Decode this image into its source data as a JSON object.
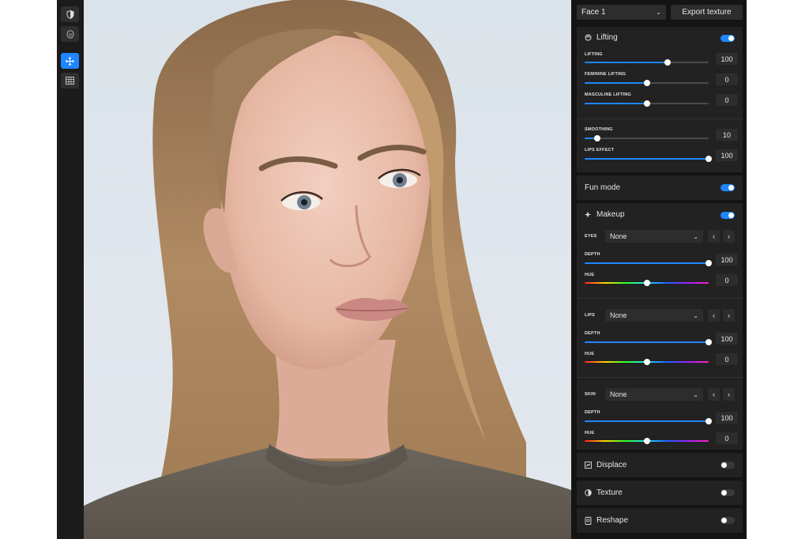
{
  "toolbar": {
    "tools": [
      {
        "name": "shield-icon",
        "active": false
      },
      {
        "name": "face-mask-icon",
        "active": false
      },
      {
        "name": "move-icon",
        "active": true
      },
      {
        "name": "grid-icon",
        "active": false
      }
    ]
  },
  "panel": {
    "face_select": "Face 1",
    "export_label": "Export texture",
    "lifting": {
      "title": "Lifting",
      "enabled": true,
      "sliders": [
        {
          "label": "LIFTING",
          "value": "100",
          "fraction": 0.67
        },
        {
          "label": "FEMININE LIFTING",
          "value": "0",
          "fraction": 0.5
        },
        {
          "label": "MASCULINE LIFTING",
          "value": "0",
          "fraction": 0.5
        }
      ],
      "extra_sliders": [
        {
          "label": "SMOOTHING",
          "value": "10",
          "fraction": 0.1
        },
        {
          "label": "LIPS EFFECT",
          "value": "100",
          "fraction": 1.0
        }
      ]
    },
    "fun_mode": {
      "title": "Fun mode",
      "enabled": true
    },
    "makeup": {
      "title": "Makeup",
      "enabled": true,
      "groups": [
        {
          "label": "EYES",
          "select": "None",
          "depth_label": "DEPTH",
          "depth_value": "100",
          "depth_fraction": 1.0,
          "hue_label": "HUE",
          "hue_value": "0",
          "hue_fraction": 0.5
        },
        {
          "label": "LIPS",
          "select": "None",
          "depth_label": "DEPTH",
          "depth_value": "100",
          "depth_fraction": 1.0,
          "hue_label": "HUE",
          "hue_value": "0",
          "hue_fraction": 0.5
        },
        {
          "label": "SKIN",
          "select": "None",
          "depth_label": "DEPTH",
          "depth_value": "100",
          "depth_fraction": 1.0,
          "hue_label": "HUE",
          "hue_value": "0",
          "hue_fraction": 0.5
        }
      ]
    },
    "displace": {
      "title": "Displace",
      "enabled": false
    },
    "texture": {
      "title": "Texture",
      "enabled": false
    },
    "reshape": {
      "title": "Reshape",
      "enabled": false
    }
  },
  "colors": {
    "accent": "#1f86ff",
    "panel_bg": "#222222"
  }
}
